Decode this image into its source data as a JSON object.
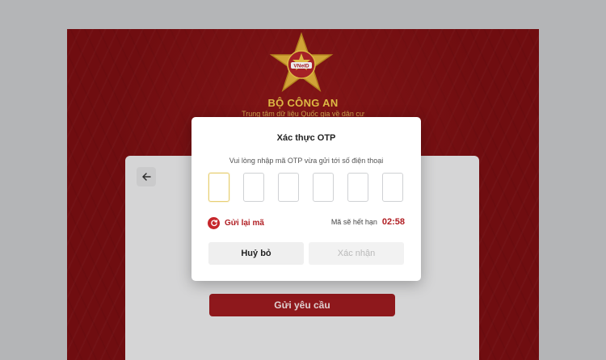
{
  "header": {
    "title": "BỘ CÔNG AN",
    "subtitle": "Trung tâm dữ liệu Quốc gia về dân cư",
    "emblem_text": "VNeID"
  },
  "background_form": {
    "request_button_label": "Gửi yêu cầu"
  },
  "otp_modal": {
    "title": "Xác thực OTP",
    "instruction": "Vui lòng nhập mã OTP vừa gửi tới số điện thoại",
    "digits": [
      "",
      "",
      "",
      "",
      "",
      ""
    ],
    "active_index": 0,
    "resend_label": "Gửi lại mã",
    "expiry_label": "Mã sẽ hết hạn",
    "expiry_timer": "02:58",
    "cancel_label": "Huỷ bỏ",
    "confirm_label": "Xác nhận"
  },
  "colors": {
    "brand_red": "#7a0f12",
    "accent_red": "#b01e23",
    "gold": "#f0c94a"
  }
}
